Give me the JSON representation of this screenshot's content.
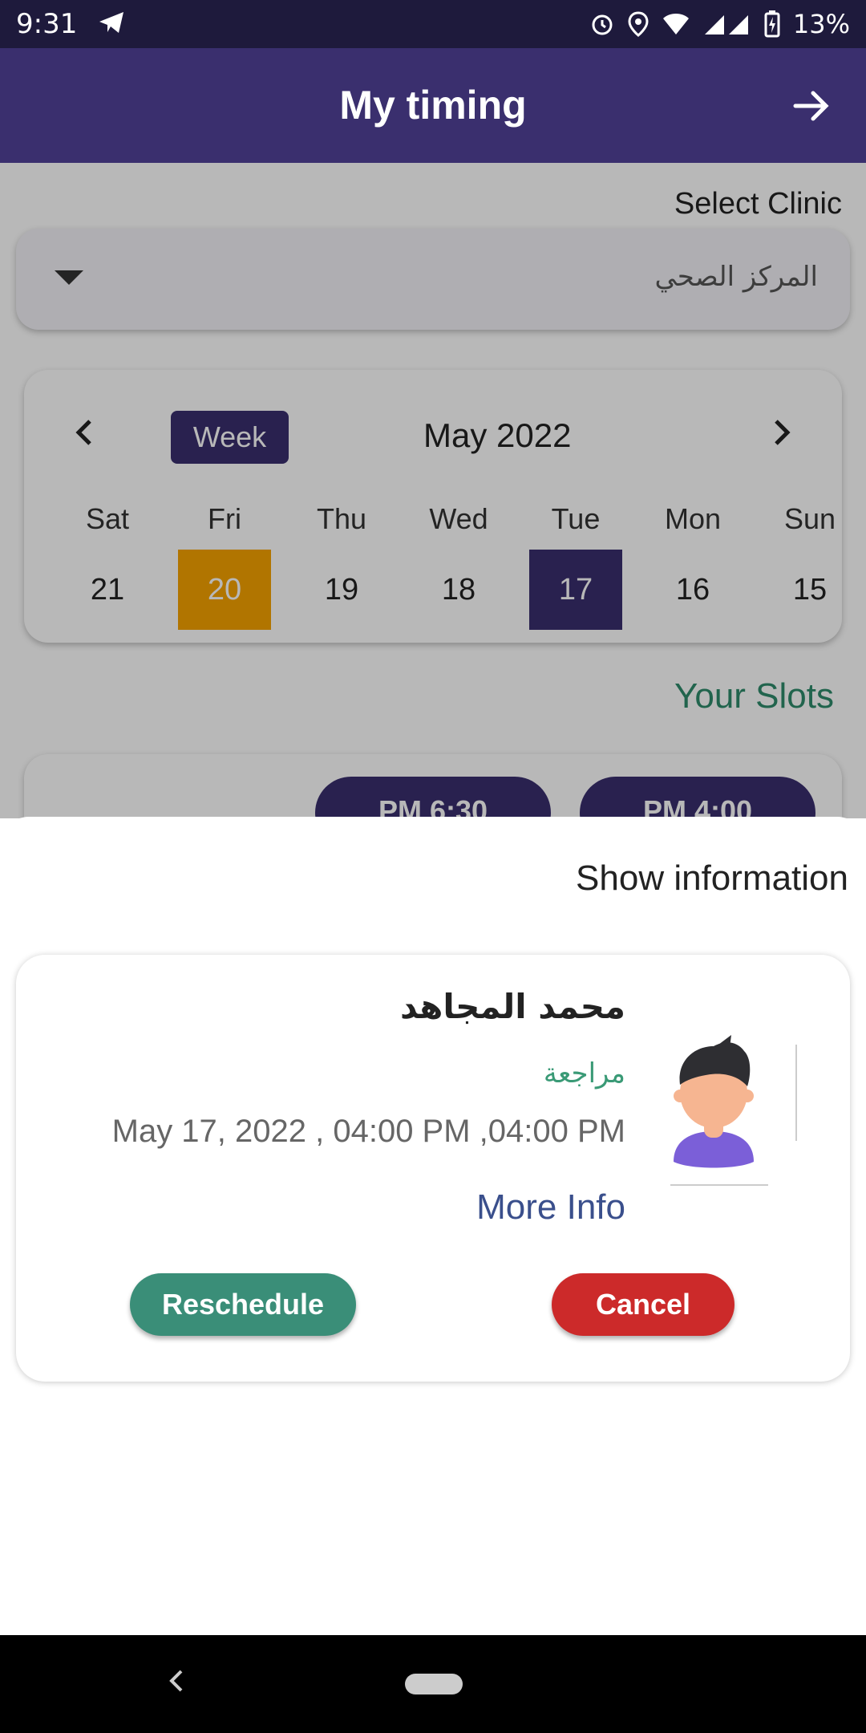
{
  "status_bar": {
    "time": "9:31",
    "battery": "13%"
  },
  "app_bar": {
    "title": "My timing"
  },
  "clinic": {
    "label": "Select Clinic",
    "selected": "المركز الصحي"
  },
  "calendar": {
    "week_button": "Week",
    "month": "May 2022",
    "days": [
      {
        "name": "Sat",
        "num": "21"
      },
      {
        "name": "Fri",
        "num": "20",
        "state": "highlighted"
      },
      {
        "name": "Thu",
        "num": "19"
      },
      {
        "name": "Wed",
        "num": "18"
      },
      {
        "name": "Tue",
        "num": "17",
        "state": "selected"
      },
      {
        "name": "Mon",
        "num": "16"
      },
      {
        "name": "Sun",
        "num": "15"
      }
    ]
  },
  "slots": {
    "heading": "Your Slots",
    "items": [
      "PM 6:30",
      "PM 4:00"
    ]
  },
  "sheet": {
    "title": "Show information",
    "patient_name": "محمد المجاهد",
    "visit_type": "مراجعة",
    "datetime": "May 17, 2022 , 04:00 PM ,04:00 PM",
    "more_info": "More Info",
    "reschedule": "Reschedule",
    "cancel": "Cancel"
  },
  "colors": {
    "primary": "#3a2f6e",
    "highlight": "#f5a300",
    "accent_green": "#3a8e78",
    "cancel_red": "#cc2a2a",
    "link_blue": "#3a4f8c"
  },
  "icons": [
    "telegram-icon",
    "alarm-icon",
    "location-icon",
    "wifi-icon",
    "signal-icon",
    "battery-icon",
    "arrow-right-icon",
    "caret-down-icon",
    "chevron-left-icon",
    "chevron-right-icon",
    "avatar-icon"
  ]
}
